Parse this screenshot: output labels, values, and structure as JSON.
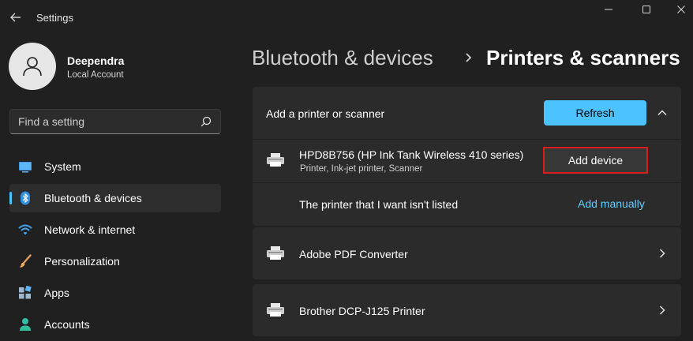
{
  "window": {
    "title": "Settings",
    "back_icon": "back-arrow-icon",
    "controls": [
      "minimize-icon",
      "maximize-icon",
      "close-icon"
    ]
  },
  "user": {
    "name": "Deependra",
    "account_type": "Local Account"
  },
  "search": {
    "placeholder": "Find a setting",
    "value": ""
  },
  "sidebar": {
    "items": [
      {
        "label": "System",
        "icon": "system-icon",
        "active": false
      },
      {
        "label": "Bluetooth & devices",
        "icon": "bluetooth-icon",
        "active": true
      },
      {
        "label": "Network & internet",
        "icon": "wifi-icon",
        "active": false
      },
      {
        "label": "Personalization",
        "icon": "brush-icon",
        "active": false
      },
      {
        "label": "Apps",
        "icon": "apps-icon",
        "active": false
      },
      {
        "label": "Accounts",
        "icon": "person-icon",
        "active": false
      }
    ]
  },
  "breadcrumb": {
    "parent": "Bluetooth & devices",
    "separator": "›",
    "current": "Printers & scanners"
  },
  "add_printer": {
    "label": "Add a printer or scanner",
    "refresh_label": "Refresh",
    "expanded": true,
    "found_device": {
      "name": "HPD8B756 (HP Ink Tank Wireless 410 series)",
      "description": "Printer, Ink-jet printer, Scanner",
      "button_label": "Add device"
    },
    "not_listed": {
      "label": "The printer that I want isn't listed",
      "link_label": "Add manually"
    }
  },
  "printers": [
    {
      "name": "Adobe PDF Converter"
    },
    {
      "name": "Brother DCP-J125 Printer"
    }
  ],
  "colors": {
    "accent": "#4cc2ff",
    "link": "#60cdff",
    "highlight_border": "#d81e1e",
    "background": "#202020",
    "card": "#2b2b2b"
  }
}
